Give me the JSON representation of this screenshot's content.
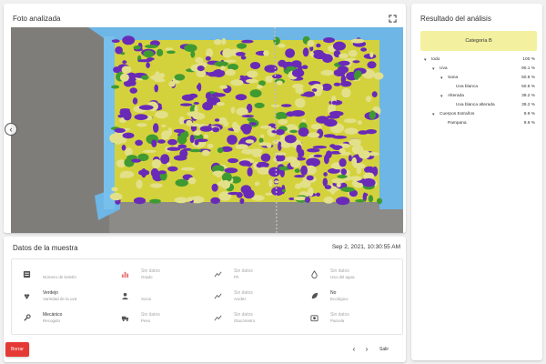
{
  "photo_card": {
    "title": "Foto analizada",
    "fullscreen_icon": "fullscreen-icon",
    "nav_prev_icon": "chevron-left-icon"
  },
  "sample_data": {
    "title": "Datos de la muestra",
    "date": "Sep 2, 2021, 10:30:55 AM",
    "fields": [
      {
        "icon": "form-icon",
        "value": "",
        "label": "Número de boletín",
        "muted": false
      },
      {
        "icon": "chart-bar-icon",
        "value": "Sin datos",
        "label": "Grado",
        "muted": true
      },
      {
        "icon": "trend-icon",
        "value": "Sin datos",
        "label": "Ph",
        "muted": true
      },
      {
        "icon": "water-drop-icon",
        "value": "Sin datos",
        "label": "Uso del agua",
        "muted": true
      },
      {
        "icon": "grape-icon",
        "value": "Verdejo",
        "label": "Variedad de la uva",
        "muted": false
      },
      {
        "icon": "person-icon",
        "value": "",
        "label": "Socio",
        "muted": false
      },
      {
        "icon": "trend-icon",
        "value": "Sin datos",
        "label": "Acidez",
        "muted": true
      },
      {
        "icon": "leaf-icon",
        "value": "No",
        "label": "Ecológico",
        "muted": false
      },
      {
        "icon": "wrench-icon",
        "value": "Mecánico",
        "label": "Recogido",
        "muted": false
      },
      {
        "icon": "truck-icon",
        "value": "Sin datos",
        "label": "Peso",
        "muted": true
      },
      {
        "icon": "trend-icon",
        "value": "Sin datos",
        "label": "Glucómetro",
        "muted": true
      },
      {
        "icon": "photo-icon",
        "value": "Sin datos",
        "label": "Parcela",
        "muted": true
      }
    ]
  },
  "actions": {
    "delete_label": "Borrar",
    "prev_icon": "chevron-left-icon",
    "next_icon": "chevron-right-icon",
    "exit_label": "Salir"
  },
  "results": {
    "title": "Resultado del análisis",
    "category": "Categoría B",
    "category_color": "#f3f1a0",
    "tree": [
      {
        "name": "todo",
        "pct": "100 %",
        "depth": 0,
        "expanded": true
      },
      {
        "name": "Uva",
        "pct": "90.1 %",
        "depth": 1,
        "expanded": true
      },
      {
        "name": "Sana",
        "pct": "50.8 %",
        "depth": 2,
        "expanded": true
      },
      {
        "name": "Uva blanca",
        "pct": "50.8 %",
        "depth": 3,
        "expanded": null
      },
      {
        "name": "Alterada",
        "pct": "39.2 %",
        "depth": 2,
        "expanded": true
      },
      {
        "name": "Uva blanca alterada",
        "pct": "39.2 %",
        "depth": 3,
        "expanded": null
      },
      {
        "name": "Cuerpos Extraños",
        "pct": "9.9 %",
        "depth": 1,
        "expanded": true
      },
      {
        "name": "Pampana",
        "pct": "9.9 %",
        "depth": 2,
        "expanded": null
      }
    ]
  },
  "colors": {
    "healthy_grape": "#d4d23c",
    "altered_grape": "#6a2ab8",
    "foreign_bodies": "#3f9a32",
    "delete_button": "#e53935"
  }
}
